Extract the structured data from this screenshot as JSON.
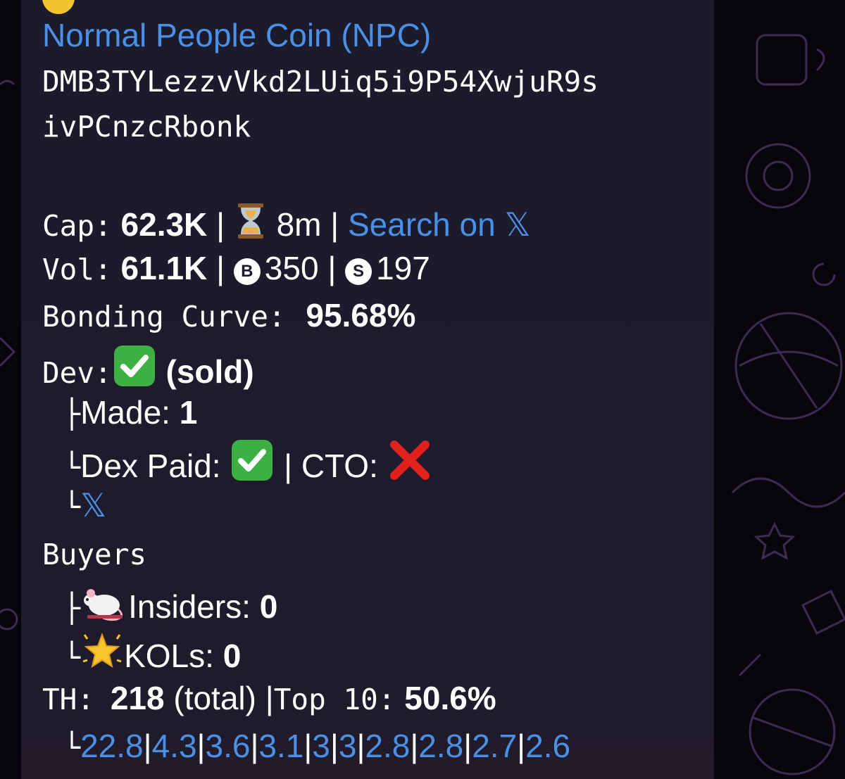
{
  "token": {
    "name": "Normal People Coin (NPC)",
    "address_line1": "DMB3TYLezzvVkd2LUiq5i9P54XwjuR9s",
    "address_line2": "ivPCnzcRbonk"
  },
  "cap": {
    "label": "Cap:",
    "value": "62.3K",
    "age": "8m",
    "search_label": "Search on",
    "x_glyph": "𝕏"
  },
  "vol": {
    "label": "Vol:",
    "value": "61.1K",
    "buy_icon": "B",
    "buys": "350",
    "sell_icon": "S",
    "sells": "197"
  },
  "bonding": {
    "label": "Bonding Curve:",
    "value": "95.68%"
  },
  "dev": {
    "label": "Dev:",
    "status": "(sold)",
    "made_label": "Made:",
    "made_value": "1",
    "dex_paid_label": "Dex Paid:",
    "cto_label": "| CTO:",
    "x_glyph": "𝕏"
  },
  "buyers": {
    "label": "Buyers",
    "insiders_label": "Insiders:",
    "insiders_value": "0",
    "kols_label": "KOLs:",
    "kols_value": "0"
  },
  "th": {
    "label": "TH:",
    "total": "218",
    "total_suffix": "(total)",
    "top_label": "Top 10:",
    "top_value": "50.6%",
    "holders": [
      "22.8",
      "4.3",
      "3.6",
      "3.1",
      "3",
      "3",
      "2.8",
      "2.8",
      "2.7",
      "2.6"
    ]
  },
  "glyphs": {
    "tree_mid": "├",
    "tree_end": "└",
    "pipe": "|"
  },
  "icons": {
    "hourglass": "hourglass-icon",
    "check": "check-mark-icon",
    "cross": "cross-mark-icon",
    "rat": "rat-icon",
    "star": "glowing-star-icon"
  },
  "colors": {
    "link": "#4a90e6",
    "bubble": "#1d1b2c",
    "check_green": "#3cb043",
    "cross_red": "#e0201b"
  }
}
